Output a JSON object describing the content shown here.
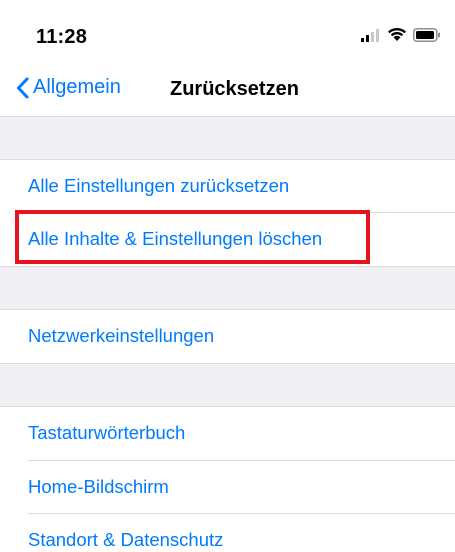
{
  "status_bar": {
    "time": "11:28",
    "icons": [
      "signal-icon",
      "wifi-icon",
      "battery-icon"
    ]
  },
  "nav": {
    "back_label": "Allgemein",
    "title": "Zurücksetzen"
  },
  "sections": [
    {
      "items": [
        {
          "label": "Alle Einstellungen zurücksetzen"
        },
        {
          "label": "Alle Inhalte & Einstellungen löschen",
          "highlighted": true
        }
      ]
    },
    {
      "items": [
        {
          "label": "Netzwerkeinstellungen"
        }
      ]
    },
    {
      "items": [
        {
          "label": "Tastaturwörterbuch"
        },
        {
          "label": "Home-Bildschirm"
        },
        {
          "label": "Standort & Datenschutz"
        }
      ]
    }
  ],
  "colors": {
    "accent": "#007aff",
    "highlight": "#e8141d",
    "group_background": "#efeff4"
  }
}
